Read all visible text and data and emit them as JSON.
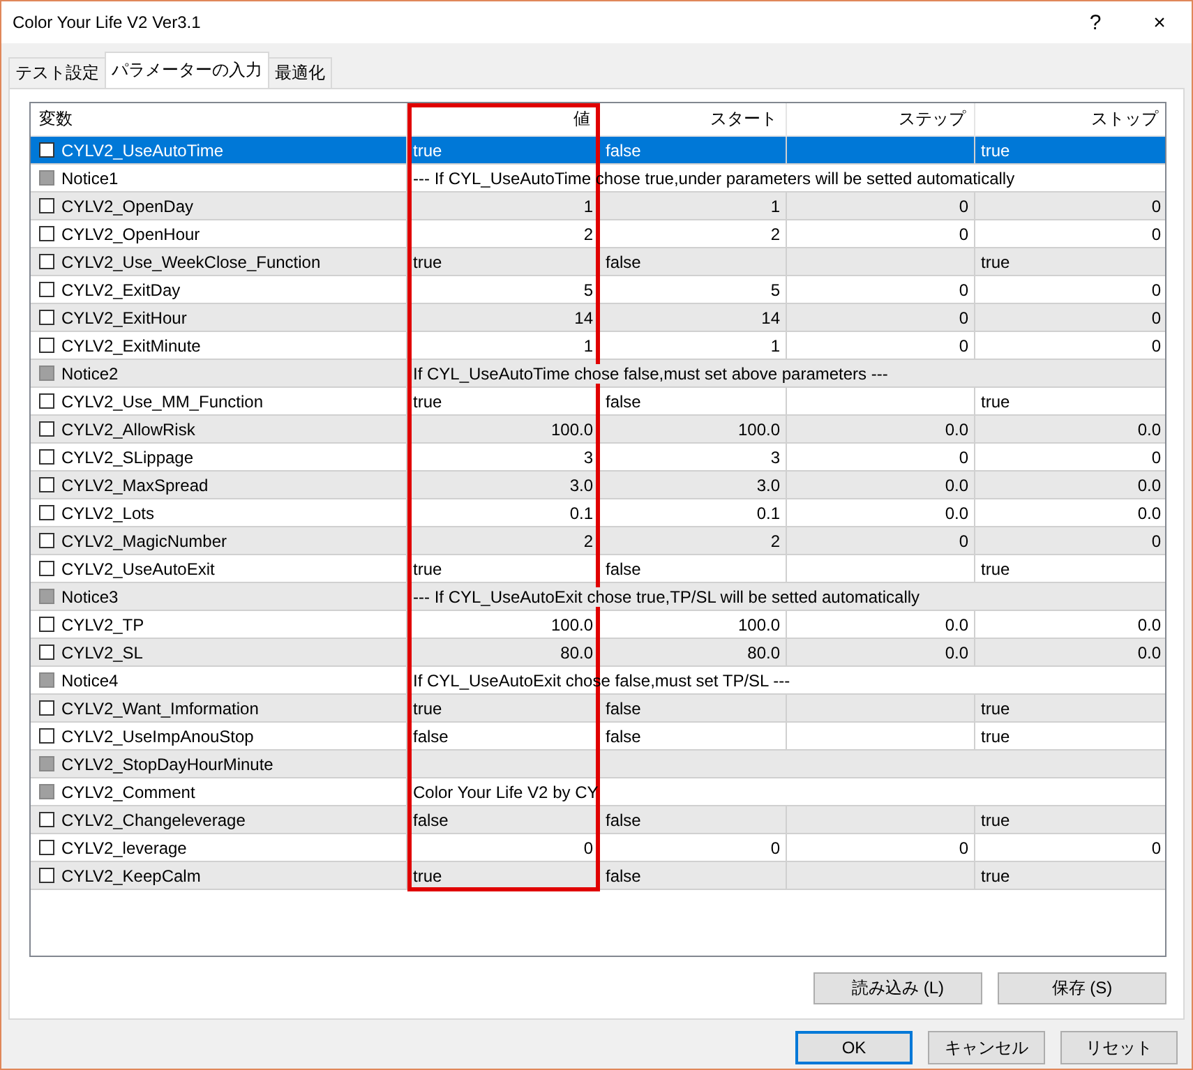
{
  "window": {
    "title": "Color Your Life V2 Ver3.1",
    "controls": [
      "?",
      "×"
    ]
  },
  "tabs": [
    {
      "label": "テスト設定",
      "selected": false
    },
    {
      "label": "パラメーターの入力",
      "selected": true
    },
    {
      "label": "最適化",
      "selected": false
    }
  ],
  "table": {
    "columns": [
      "変数",
      "値",
      "スタート",
      "ステップ",
      "ストップ"
    ],
    "rows": [
      {
        "kind": "switch",
        "name": "CYLV2_UseAutoTime",
        "checked": false,
        "selected": true,
        "value": "true",
        "start": "false",
        "stop": "true"
      },
      {
        "kind": "notice",
        "name": "Notice1",
        "checked": false,
        "selected": false,
        "text": "--- If CYL_UseAutoTime chose true,under parameters will be setted automatically"
      },
      {
        "kind": "number",
        "name": "CYLV2_OpenDay",
        "checked": false,
        "selected": false,
        "value": "1",
        "start": "1",
        "step": "0",
        "stop": "0"
      },
      {
        "kind": "number",
        "name": "CYLV2_OpenHour",
        "checked": false,
        "selected": false,
        "value": "2",
        "start": "2",
        "step": "0",
        "stop": "0"
      },
      {
        "kind": "switch",
        "name": "CYLV2_Use_WeekClose_Function",
        "checked": false,
        "selected": false,
        "value": "true",
        "start": "false",
        "stop": "true"
      },
      {
        "kind": "number",
        "name": "CYLV2_ExitDay",
        "checked": false,
        "selected": false,
        "value": "5",
        "start": "5",
        "step": "0",
        "stop": "0"
      },
      {
        "kind": "number",
        "name": "CYLV2_ExitHour",
        "checked": false,
        "selected": false,
        "value": "14",
        "start": "14",
        "step": "0",
        "stop": "0"
      },
      {
        "kind": "number",
        "name": "CYLV2_ExitMinute",
        "checked": false,
        "selected": false,
        "value": "1",
        "start": "1",
        "step": "0",
        "stop": "0"
      },
      {
        "kind": "notice",
        "name": "Notice2",
        "checked": false,
        "selected": false,
        "text": "If CYL_UseAutoTime chose false,must set above parameters ---"
      },
      {
        "kind": "switch",
        "name": "CYLV2_Use_MM_Function",
        "checked": false,
        "selected": false,
        "value": "true",
        "start": "false",
        "stop": "true"
      },
      {
        "kind": "number",
        "name": "CYLV2_AllowRisk",
        "checked": false,
        "selected": false,
        "value": "100.0",
        "start": "100.0",
        "step": "0.0",
        "stop": "0.0"
      },
      {
        "kind": "number",
        "name": "CYLV2_SLippage",
        "checked": false,
        "selected": false,
        "value": "3",
        "start": "3",
        "step": "0",
        "stop": "0"
      },
      {
        "kind": "number",
        "name": "CYLV2_MaxSpread",
        "checked": false,
        "selected": false,
        "value": "3.0",
        "start": "3.0",
        "step": "0.0",
        "stop": "0.0"
      },
      {
        "kind": "number",
        "name": "CYLV2_Lots",
        "checked": false,
        "selected": false,
        "value": "0.1",
        "start": "0.1",
        "step": "0.0",
        "stop": "0.0"
      },
      {
        "kind": "number",
        "name": "CYLV2_MagicNumber",
        "checked": false,
        "selected": false,
        "value": "2",
        "start": "2",
        "step": "0",
        "stop": "0"
      },
      {
        "kind": "switch",
        "name": "CYLV2_UseAutoExit",
        "checked": false,
        "selected": false,
        "value": "true",
        "start": "false",
        "stop": "true"
      },
      {
        "kind": "notice",
        "name": "Notice3",
        "checked": false,
        "selected": false,
        "text": "--- If  CYL_UseAutoExit chose true,TP/SL will be setted automatically"
      },
      {
        "kind": "number",
        "name": "CYLV2_TP",
        "checked": false,
        "selected": false,
        "value": "100.0",
        "start": "100.0",
        "step": "0.0",
        "stop": "0.0"
      },
      {
        "kind": "number",
        "name": "CYLV2_SL",
        "checked": false,
        "selected": false,
        "value": "80.0",
        "start": "80.0",
        "step": "0.0",
        "stop": "0.0"
      },
      {
        "kind": "notice",
        "name": "Notice4",
        "checked": false,
        "selected": false,
        "text": "If  CYL_UseAutoExit chose false,must set TP/SL ---"
      },
      {
        "kind": "switch",
        "name": "CYLV2_Want_Imformation",
        "checked": false,
        "selected": false,
        "value": "true",
        "start": "false",
        "stop": "true"
      },
      {
        "kind": "switch",
        "name": "CYLV2_UseImpAnouStop",
        "checked": false,
        "selected": false,
        "value": "false",
        "start": "false",
        "stop": "true"
      },
      {
        "kind": "notice",
        "name": "CYLV2_StopDayHourMinute",
        "checked": false,
        "selected": false
      },
      {
        "kind": "notice",
        "name": "CYLV2_Comment",
        "checked": false,
        "selected": false,
        "text": "Color Your Life V2 by CY"
      },
      {
        "kind": "switch",
        "name": "CYLV2_Changeleverage",
        "checked": false,
        "selected": false,
        "value": "false",
        "start": "false",
        "stop": "true"
      },
      {
        "kind": "number",
        "name": "CYLV2_leverage",
        "checked": false,
        "selected": false,
        "value": "0",
        "start": "0",
        "step": "0",
        "stop": "0"
      },
      {
        "kind": "switch",
        "name": "CYLV2_KeepCalm",
        "checked": false,
        "selected": false,
        "value": "true",
        "start": "false",
        "stop": "true"
      }
    ]
  },
  "file_buttons": [
    "読み込み (L)",
    "保存 (S)"
  ],
  "buttons": [
    {
      "label": "OK",
      "default": true
    },
    {
      "label": "キャンセル",
      "default": false
    },
    {
      "label": "リセット",
      "default": false
    }
  ]
}
